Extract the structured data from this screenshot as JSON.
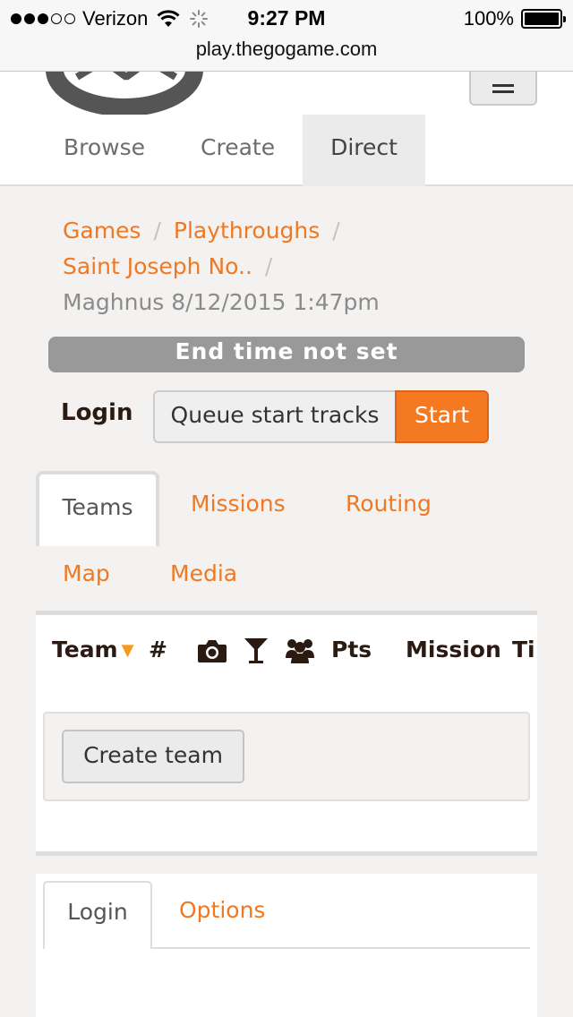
{
  "status_bar": {
    "carrier": "Verizon",
    "time": "9:27 PM",
    "battery": "100%",
    "signal_bars_filled": 3,
    "signal_bars_total": 5
  },
  "browser": {
    "url": "play.thegogame.com"
  },
  "nav": {
    "items": [
      {
        "label": "Browse",
        "active": false
      },
      {
        "label": "Create",
        "active": false
      },
      {
        "label": "Direct",
        "active": true
      }
    ],
    "menu_icon": "hamburger-menu-icon"
  },
  "breadcrumb": {
    "games": "Games",
    "playthroughs": "Playthroughs",
    "game_name": "Saint Joseph No..",
    "separator": "/",
    "current": "Maghnus 8/12/2015 1:47pm"
  },
  "end_time": "End time not set",
  "login_row": {
    "label": "Login",
    "queue_button": "Queue start tracks",
    "start_button": "Start"
  },
  "tabs": [
    {
      "label": "Teams",
      "active": true
    },
    {
      "label": "Missions",
      "active": false
    },
    {
      "label": "Routing",
      "active": false
    },
    {
      "label": "Map",
      "active": false
    },
    {
      "label": "Media",
      "active": false
    }
  ],
  "teams_table": {
    "headers": {
      "team": "Team",
      "number": "#",
      "photo_icon": "camera-icon",
      "drink_icon": "cocktail-icon",
      "group_icon": "users-icon",
      "points": "Pts",
      "mission": "Mission",
      "time": "Ti"
    },
    "sort_icon": "sort-down-caret-icon",
    "create_team_button": "Create team"
  },
  "lower_tabs": [
    {
      "label": "Login",
      "active": true
    },
    {
      "label": "Options",
      "active": false
    }
  ],
  "colors": {
    "accent": "#f07822",
    "start_button": "#f47920",
    "end_bar": "#999999",
    "text_dark": "#2b1a12",
    "page_bg": "#f3f2f0"
  }
}
